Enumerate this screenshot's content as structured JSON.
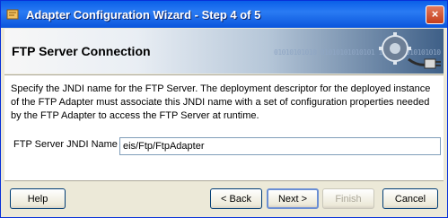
{
  "window": {
    "title": "Adapter Configuration Wizard - Step 4 of 5",
    "close_label": "×"
  },
  "banner": {
    "title": "FTP Server Connection",
    "binary_text": "01010101010 01010101010101\n1010101010101010 101011010"
  },
  "content": {
    "description": "Specify the JNDI name for the FTP Server.  The deployment descriptor for the deployed instance of the FTP Adapter must associate this JNDI name with a set of configuration properties needed by the FTP Adapter to access the FTP Server at runtime.",
    "jndi_label": "FTP Server JNDI Name",
    "jndi_value": "eis/Ftp/FtpAdapter"
  },
  "buttons": {
    "help": "Help",
    "back": "< Back",
    "next": "Next >",
    "finish": "Finish",
    "cancel": "Cancel"
  },
  "colors": {
    "titlebar": "#0a5fe8",
    "dialog_bg": "#ece9d8",
    "input_border": "#7f9db9"
  }
}
